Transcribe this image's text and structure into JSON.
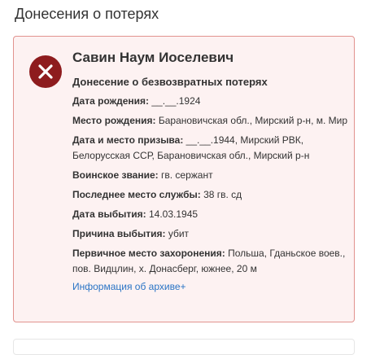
{
  "section": {
    "title": "Донесения о потерях"
  },
  "record": {
    "icon": "close-x-icon",
    "name": "Савин Наум Иоселевич",
    "report_type": "Донесение о безвозвратных потерях",
    "fields": [
      {
        "label": "Дата рождения:",
        "value": "__.__.1924"
      },
      {
        "label": "Место рождения:",
        "value": "Барановичская обл., Мирский р-н, м. Мир"
      },
      {
        "label": "Дата и место призыва:",
        "value": "__.__.1944, Мирский РВК, Белорусская ССР, Барановичская обл., Мирский р-н"
      },
      {
        "label": "Воинское звание:",
        "value": "гв. сержант"
      },
      {
        "label": "Последнее место службы:",
        "value": "38 гв. сд"
      },
      {
        "label": "Дата выбытия:",
        "value": "14.03.1945"
      },
      {
        "label": "Причина выбытия:",
        "value": "убит"
      },
      {
        "label": "Первичное место захоронения:",
        "value": "Польша, Гданьское воев., пов. Видцлин, х. Донасберг, южнее, 20 м"
      }
    ],
    "archive_link": "Информация об архиве+"
  },
  "colors": {
    "card_background": "#fdf2f2",
    "card_border": "#e2938f",
    "icon_background": "#8e1c1e",
    "link": "#2a74c5"
  }
}
